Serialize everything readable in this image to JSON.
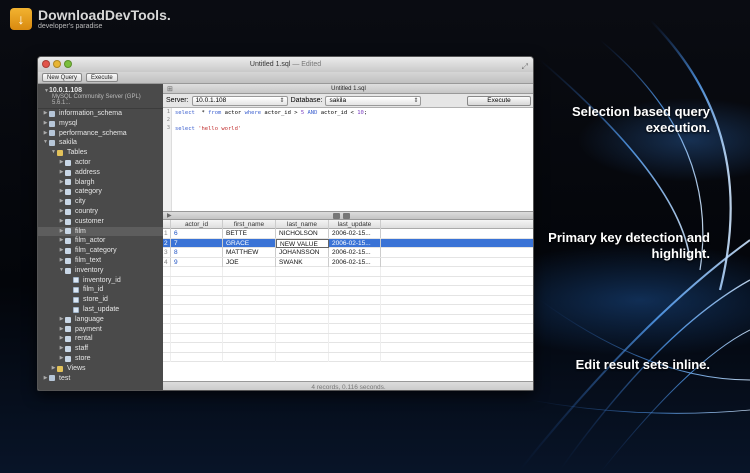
{
  "watermark": {
    "title": "DownloadDevTools.",
    "subtitle": "developer's paradise",
    "logo_glyph": "↓"
  },
  "captions": [
    "Selection based query execution.",
    "Primary key detection and highlight.",
    "Edit result sets inline."
  ],
  "window": {
    "title": "Untitled 1.sql",
    "edited": "— Edited",
    "toolbar": {
      "new_query": "New Query",
      "execute": "Execute"
    }
  },
  "sidebar": {
    "server": "10.0.1.108",
    "server_version": "MySQL Community Server (GPL) 5.6.1...",
    "items": [
      {
        "label": "information_schema",
        "level": 1,
        "type": "db",
        "expanded": false
      },
      {
        "label": "mysql",
        "level": 1,
        "type": "db",
        "expanded": false
      },
      {
        "label": "performance_schema",
        "level": 1,
        "type": "db",
        "expanded": false
      },
      {
        "label": "sakila",
        "level": 1,
        "type": "db",
        "expanded": true
      },
      {
        "label": "Tables",
        "level": 2,
        "type": "folder",
        "expanded": true
      },
      {
        "label": "actor",
        "level": 3,
        "type": "tbl",
        "expanded": false
      },
      {
        "label": "address",
        "level": 3,
        "type": "tbl",
        "expanded": false
      },
      {
        "label": "blargh",
        "level": 3,
        "type": "tbl",
        "expanded": false
      },
      {
        "label": "category",
        "level": 3,
        "type": "tbl",
        "expanded": false
      },
      {
        "label": "city",
        "level": 3,
        "type": "tbl",
        "expanded": false
      },
      {
        "label": "country",
        "level": 3,
        "type": "tbl",
        "expanded": false
      },
      {
        "label": "customer",
        "level": 3,
        "type": "tbl",
        "expanded": false
      },
      {
        "label": "film",
        "level": 3,
        "type": "tbl",
        "expanded": false,
        "selected": true
      },
      {
        "label": "film_actor",
        "level": 3,
        "type": "tbl",
        "expanded": false
      },
      {
        "label": "film_category",
        "level": 3,
        "type": "tbl",
        "expanded": false
      },
      {
        "label": "film_text",
        "level": 3,
        "type": "tbl",
        "expanded": false
      },
      {
        "label": "inventory",
        "level": 3,
        "type": "tbl",
        "expanded": true
      },
      {
        "label": "inventory_id",
        "level": 4,
        "type": "col"
      },
      {
        "label": "film_id",
        "level": 4,
        "type": "col"
      },
      {
        "label": "store_id",
        "level": 4,
        "type": "col"
      },
      {
        "label": "last_update",
        "level": 4,
        "type": "col"
      },
      {
        "label": "language",
        "level": 3,
        "type": "tbl",
        "expanded": false
      },
      {
        "label": "payment",
        "level": 3,
        "type": "tbl",
        "expanded": false
      },
      {
        "label": "rental",
        "level": 3,
        "type": "tbl",
        "expanded": false
      },
      {
        "label": "staff",
        "level": 3,
        "type": "tbl",
        "expanded": false
      },
      {
        "label": "store",
        "level": 3,
        "type": "tbl",
        "expanded": false
      },
      {
        "label": "Views",
        "level": 2,
        "type": "folder",
        "expanded": false
      },
      {
        "label": "test",
        "level": 1,
        "type": "db",
        "expanded": false
      }
    ]
  },
  "editor": {
    "tab_title": "Untitled 1.sql",
    "server_label": "Server:",
    "server_value": "10.0.1.108",
    "database_label": "Database:",
    "database_value": "sakila",
    "execute_label": "Execute",
    "lines": [
      {
        "n": "1",
        "parts": [
          [
            "kw",
            "select"
          ],
          [
            "",
            "  * "
          ],
          [
            "kw",
            "from"
          ],
          [
            "",
            " actor "
          ],
          [
            "kw",
            "where"
          ],
          [
            "",
            " actor_id > "
          ],
          [
            "num",
            "5"
          ],
          [
            "",
            " "
          ],
          [
            "kw",
            "AND"
          ],
          [
            "",
            " actor_id < "
          ],
          [
            "num",
            "10"
          ],
          [
            "",
            ";"
          ]
        ]
      },
      {
        "n": "2",
        "parts": []
      },
      {
        "n": "3",
        "parts": [
          [
            "kw",
            "select"
          ],
          [
            "",
            " "
          ],
          [
            "str",
            "'hello world'"
          ]
        ]
      }
    ]
  },
  "results": {
    "columns": [
      "actor_id",
      "first_name",
      "last_name",
      "last_update"
    ],
    "rows": [
      {
        "n": "1",
        "cells": [
          "6",
          "BETTE",
          "NICHOLSON",
          "2006-02-15..."
        ]
      },
      {
        "n": "2",
        "cells": [
          "7",
          "GRACE",
          "NEW VALUE",
          "2006-02-15..."
        ],
        "selected": true,
        "editing": 2
      },
      {
        "n": "3",
        "cells": [
          "8",
          "MATTHEW",
          "JOHANSSON",
          "2006-02-15..."
        ]
      },
      {
        "n": "4",
        "cells": [
          "9",
          "JOE",
          "SWANK",
          "2006-02-15..."
        ]
      }
    ],
    "status": "4 records, 0.116 seconds."
  },
  "colors": {
    "selection": "#3a73d6",
    "sidebar_bg": "#4a4a4a",
    "keyword": "#3b5fcf",
    "string": "#c23030"
  }
}
